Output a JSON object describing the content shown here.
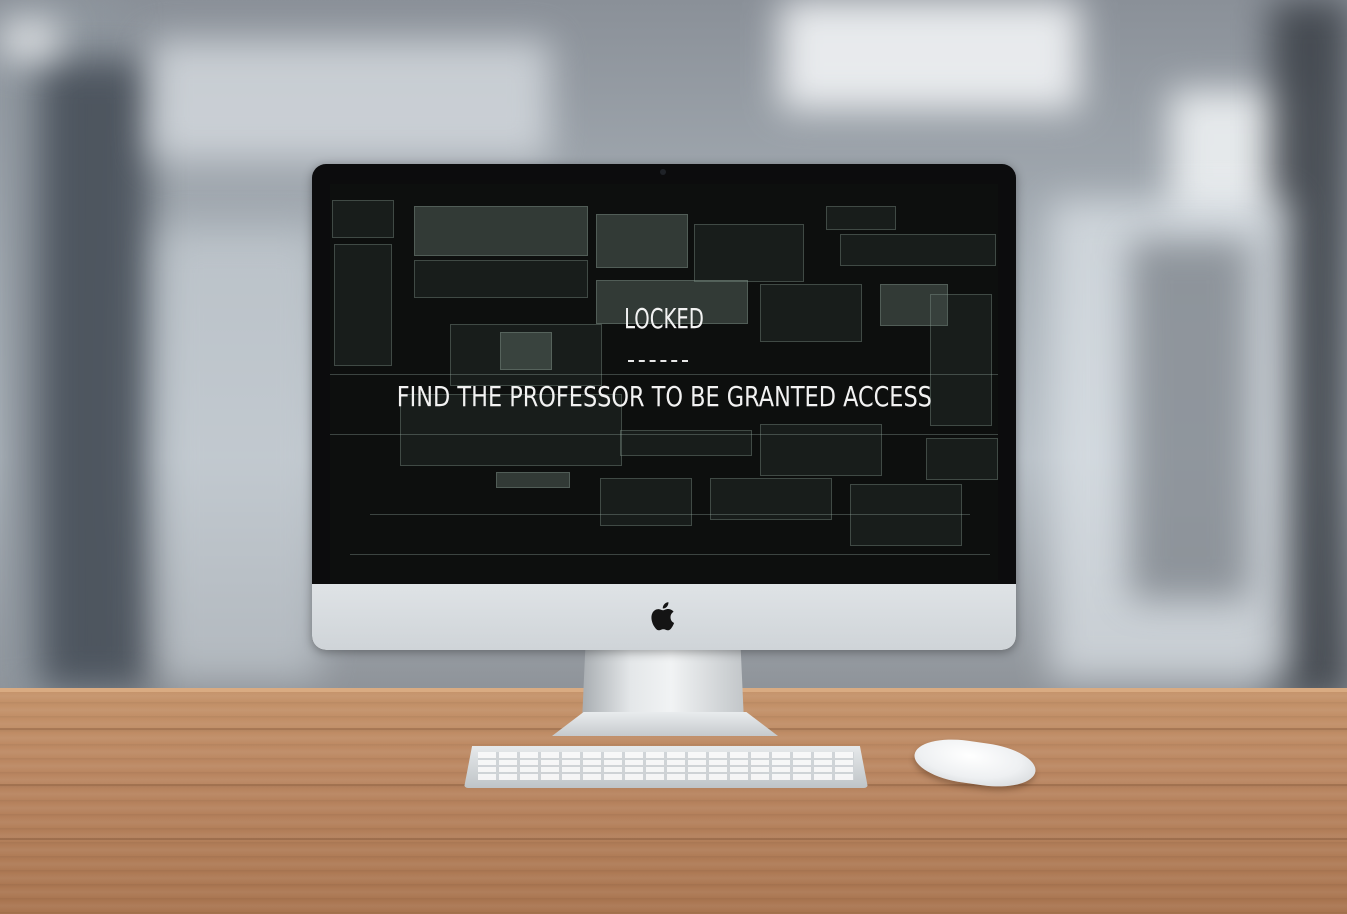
{
  "lock_screen": {
    "title": "LOCKED",
    "separator": "- - - -",
    "message": "FIND THE PROFESSOR TO BE GRANTED ACCESS"
  },
  "device": {
    "type": "iMac",
    "logo_icon": "apple-logo-icon"
  },
  "colors": {
    "screen_background": "#0d0f0e",
    "text": "#f2f2f2",
    "desk": "#b98560"
  }
}
